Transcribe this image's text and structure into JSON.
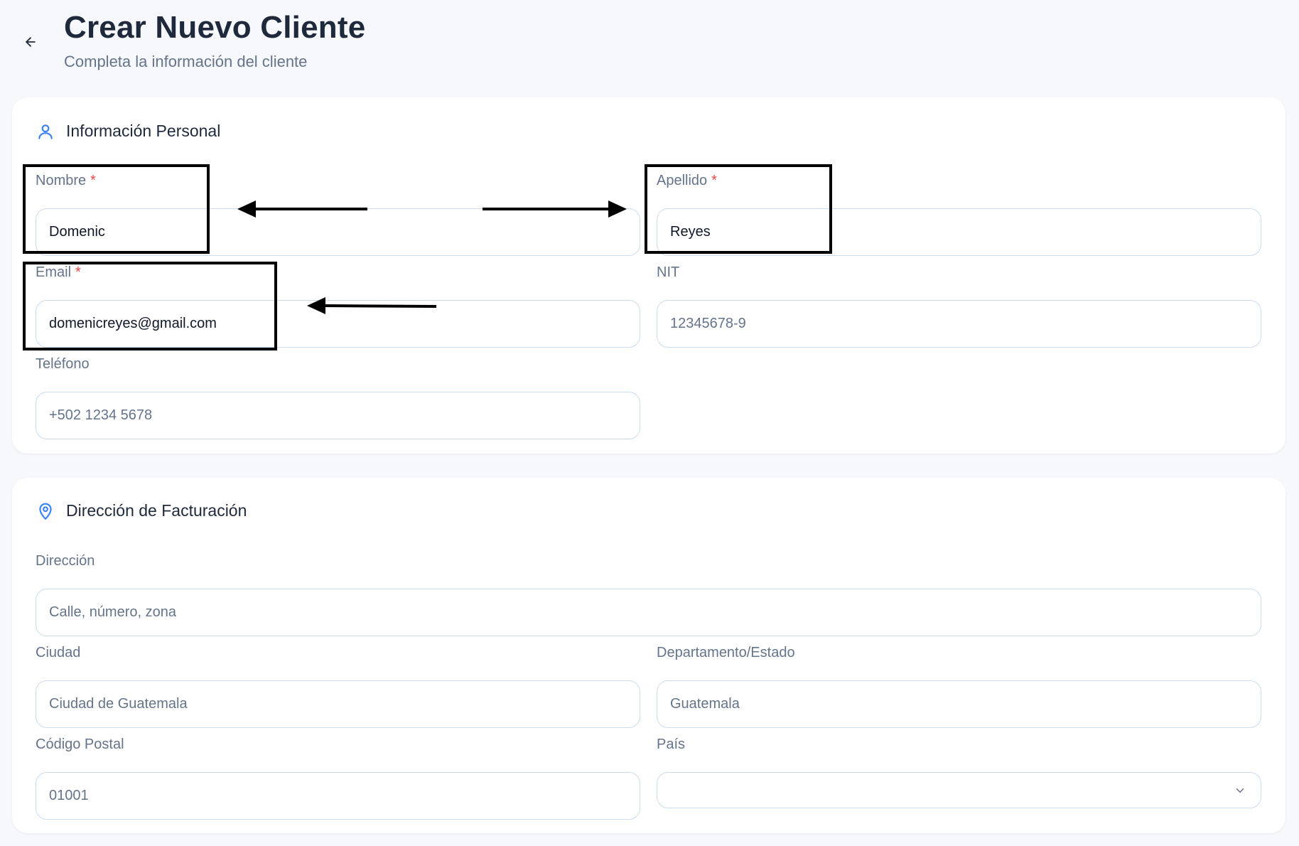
{
  "header": {
    "title": "Crear Nuevo Cliente",
    "subtitle": "Completa la información del cliente",
    "back_icon": "arrow-left-icon"
  },
  "personal": {
    "section_title": "Información Personal",
    "icon": "user-icon",
    "fields": {
      "nombre": {
        "label": "Nombre",
        "required": "*",
        "value": "Domenic"
      },
      "apellido": {
        "label": "Apellido",
        "required": "*",
        "value": "Reyes"
      },
      "email": {
        "label": "Email",
        "required": "*",
        "value": "domenicreyes@gmail.com"
      },
      "nit": {
        "label": "NIT",
        "placeholder": "12345678-9"
      },
      "telefono": {
        "label": "Teléfono",
        "placeholder": "+502 1234 5678"
      }
    }
  },
  "billing": {
    "section_title": "Dirección de Facturación",
    "icon": "map-pin-icon",
    "fields": {
      "direccion": {
        "label": "Dirección",
        "placeholder": "Calle, número, zona"
      },
      "ciudad": {
        "label": "Ciudad",
        "placeholder": "Ciudad de Guatemala"
      },
      "departamento": {
        "label": "Departamento/Estado",
        "placeholder": "Guatemala"
      },
      "codigo_postal": {
        "label": "Código Postal",
        "placeholder": "01001"
      },
      "pais": {
        "label": "País",
        "value": "",
        "icon": "chevron-down-icon"
      }
    }
  },
  "colors": {
    "accent": "#3b82f6",
    "required": "#ef4444",
    "input_border": "#cbdcf0",
    "annotation": "#000000"
  }
}
